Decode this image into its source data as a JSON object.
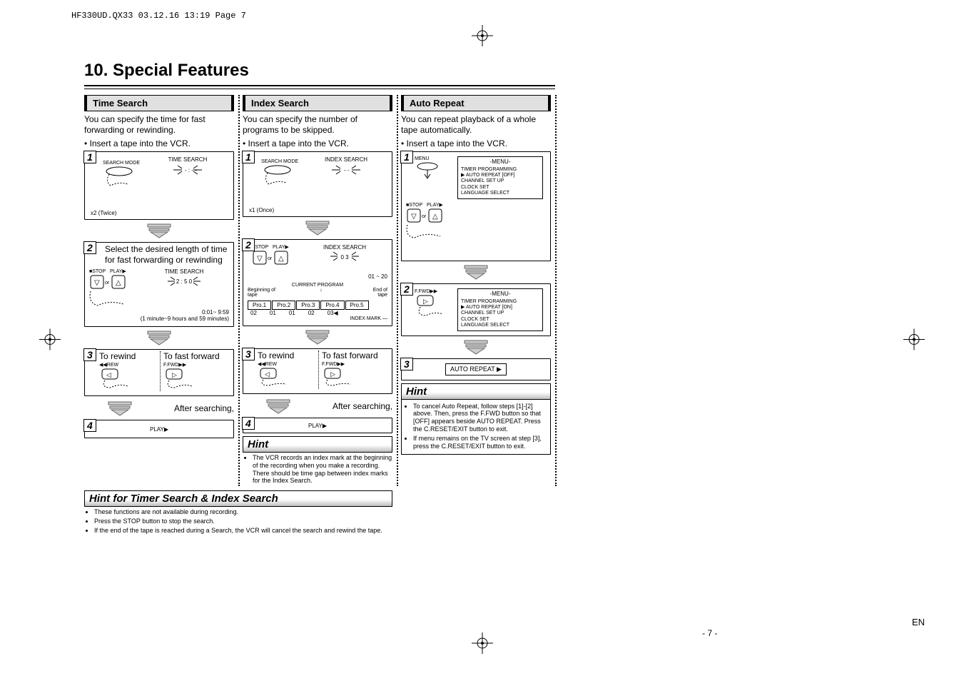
{
  "header_line": "HF330UD.QX33  03.12.16  13:19  Page 7",
  "title": "10. Special Features",
  "page_number": "- 7 -",
  "lang": "EN",
  "timeSearch": {
    "heading": "Time Search",
    "intro": "You can specify the time for fast forwarding or rewinding.",
    "bullet": "• Insert a tape into the VCR.",
    "step1": {
      "btn": "SEARCH MODE",
      "osd": "TIME SEARCH",
      "note": "x2 (Twice)"
    },
    "step2": {
      "text": "Select the desired length of time for fast forwarding or rewinding",
      "osd": "TIME SEARCH",
      "value": "2 : 5 0",
      "stop": "STOP",
      "play": "PLAY",
      "or": "or",
      "range": "0:01~ 9:59",
      "range2": "(1 minute~9 hours and 59 minutes)"
    },
    "step3": {
      "rew": "To rewind",
      "fwd": "To fast forward",
      "rew_btn": "REW",
      "fwd_btn": "F.FWD",
      "after": "After searching,"
    },
    "step4": {
      "play": "PLAY"
    }
  },
  "indexSearch": {
    "heading": "Index Search",
    "intro": "You can specify the number of programs to be skipped.",
    "bullet": "• Insert a tape into the VCR.",
    "step1": {
      "btn": "SEARCH MODE",
      "osd": "INDEX SEARCH",
      "note": "x1 (Once)"
    },
    "step2": {
      "osd": "INDEX SEARCH",
      "value": "0 3",
      "stop": "STOP",
      "play": "PLAY",
      "or": "or",
      "range": "01 ~ 20",
      "current": "CURRENT PROGRAM",
      "begin": "Beginning of tape",
      "end": "End of tape",
      "pro": [
        "Pro.1",
        "Pro.2",
        "Pro.3",
        "Pro.4",
        "Pro.5"
      ],
      "marks": [
        "02",
        "01",
        "01",
        "02",
        "03"
      ],
      "idxmark": "INDEX MARK"
    },
    "step3": {
      "rew": "To rewind",
      "fwd": "To fast forward",
      "rew_btn": "REW",
      "fwd_btn": "F.FWD",
      "after": "After searching,"
    },
    "step4": {
      "play": "PLAY"
    },
    "hint": {
      "title": "Hint",
      "items": [
        "The VCR records an index mark at the beginning of the recording when you make a recording. There should be time gap between index marks for the Index Search."
      ]
    }
  },
  "autoRepeat": {
    "heading": "Auto Repeat",
    "intro": "You can repeat playback of a whole tape automatically.",
    "bullet": "• Insert a tape into the VCR.",
    "step1": {
      "btn": "MENU",
      "stop": "STOP",
      "play": "PLAY",
      "or": "or",
      "menu_title": "-MENU-",
      "menu_items": [
        "TIMER PROGRAMMING",
        "AUTO REPEAT  [OFF]",
        "CHANNEL SET UP",
        "CLOCK SET",
        "LANGUAGE SELECT"
      ]
    },
    "step2": {
      "btn": "F.FWD",
      "menu_title": "-MENU-",
      "menu_items": [
        "TIMER PROGRAMMING",
        "AUTO REPEAT  [ON]",
        "CHANNEL SET UP",
        "CLOCK SET",
        "LANGUAGE SELECT"
      ]
    },
    "step3": {
      "label": "AUTO REPEAT ▶"
    },
    "hint": {
      "title": "Hint",
      "items": [
        "To cancel Auto Repeat, follow steps [1]-[2] above.  Then, press the F.FWD button so that [OFF] appears beside AUTO REPEAT. Press the C.RESET/EXIT button to exit.",
        "If menu remains on the TV screen at step [3], press the C.RESET/EXIT button to exit."
      ]
    }
  },
  "bottomHint": {
    "title": "Hint for Timer Search & Index Search",
    "items": [
      "These functions are not available during recording.",
      "Press the STOP button to stop the search.",
      "If the end of the tape is reached during a Search, the VCR will cancel the search and rewind the tape."
    ]
  }
}
